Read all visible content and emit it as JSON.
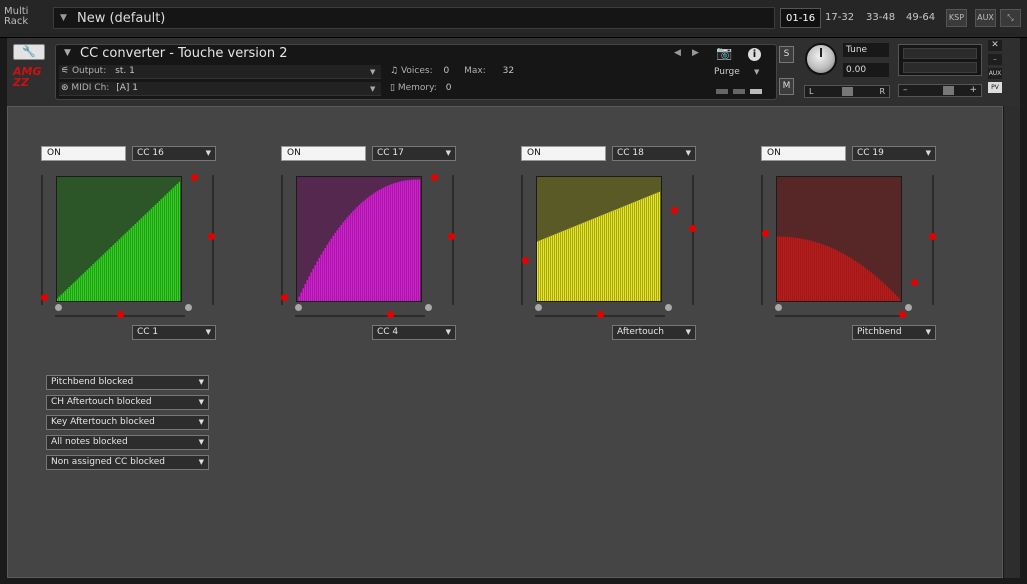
{
  "rack": {
    "label": "Multi Rack",
    "title": "New (default)",
    "pages": [
      "01-16",
      "17-32",
      "33-48",
      "49-64"
    ],
    "active_page": 0,
    "ksp": "KSP",
    "aux": "AUX"
  },
  "instrument": {
    "title": "CC converter - Touche version 2",
    "output_label": "Output:",
    "output_value": "st. 1",
    "voices_label": "Voices:",
    "voices_value": "0",
    "max_label": "Max:",
    "max_value": "32",
    "midi_label": "MIDI Ch:",
    "midi_value": "[A]  1",
    "memory_label": "Memory:",
    "memory_value": "0",
    "purge_label": "Purge",
    "solo_label": "S",
    "mute_label": "M",
    "tune_label": "Tune",
    "tune_value": "0.00",
    "pan_left": "L",
    "pan_right": "R",
    "vol_minus": "–",
    "vol_plus": "+",
    "aux_label": "AUX",
    "pv_label": "PV"
  },
  "converters": [
    {
      "on_label": "ON",
      "cc_out": "CC 16",
      "cc_in": "CC 1",
      "color": "#2bd11a",
      "bg": "#2c5528",
      "curve": "linear"
    },
    {
      "on_label": "ON",
      "cc_out": "CC 17",
      "cc_in": "CC 4",
      "color": "#d81ad8",
      "bg": "#55284f",
      "curve": "log"
    },
    {
      "on_label": "ON",
      "cc_out": "CC 18",
      "cc_in": "Aftertouch",
      "color": "#e6e61f",
      "bg": "#5a5a26",
      "curve": "offset"
    },
    {
      "on_label": "ON",
      "cc_out": "CC 19",
      "cc_in": "Pitchbend",
      "color": "#c41818",
      "bg": "#572626",
      "curve": "falling"
    }
  ],
  "blockers": [
    "Pitchbend blocked",
    "CH Aftertouch blocked",
    "Key Aftertouch blocked",
    "All notes blocked",
    "Non assigned CC blocked"
  ]
}
